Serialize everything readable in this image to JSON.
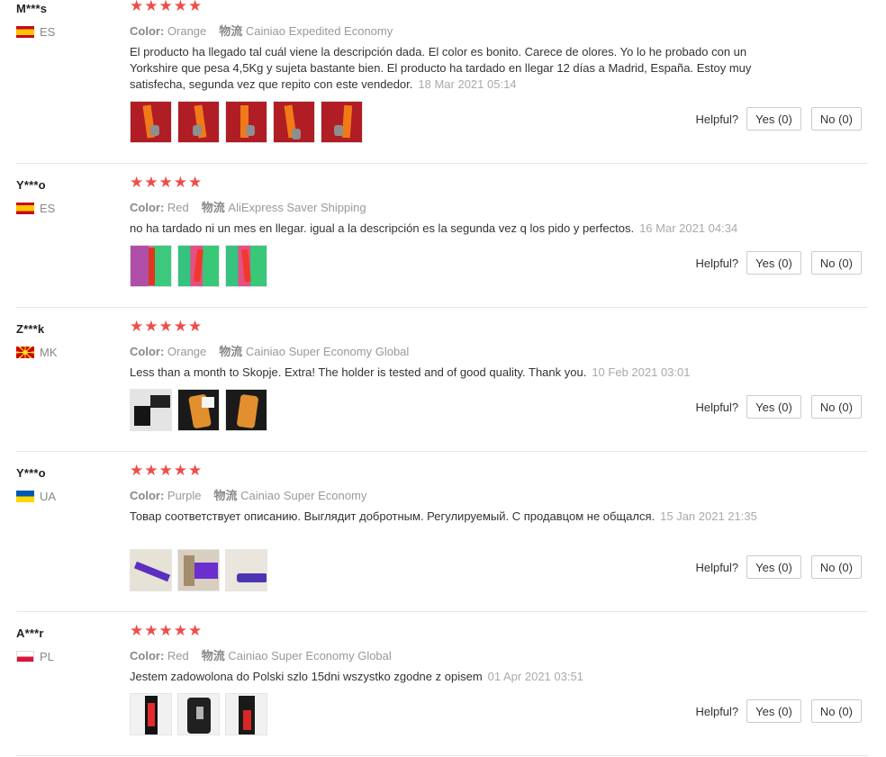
{
  "colors": {
    "star": "#f04c4c",
    "muted": "#999999",
    "divider": "#e8e8e8"
  },
  "icons": {
    "star": "★"
  },
  "reviews": [
    {
      "buyer": "M***s",
      "country": "ES",
      "flag": "es-flag-icon",
      "rating": 5,
      "color_label": "Color:",
      "color_value": "Orange",
      "shipping_label": "物流",
      "shipping": "Cainiao Expedited Economy",
      "text": "El producto ha llegado tal cuál viene la descripción dada. El color es bonito. Carece de olores. Yo lo he probado con un Yorkshire que pesa 4,5Kg y sujeta bastante bien. El producto ha tardado en llegar 12 días a Madrid, España. Estoy muy satisfecha, segunda vez que repito con este vendedor.",
      "date": "18 Mar 2021 05:14",
      "helpful_label": "Helpful?",
      "yes_label": "Yes (0)",
      "no_label": "No (0)"
    },
    {
      "buyer": "Y***o",
      "country": "ES",
      "flag": "es-flag-icon",
      "rating": 5,
      "color_label": "Color:",
      "color_value": "Red",
      "shipping_label": "物流",
      "shipping": "AliExpress Saver Shipping",
      "text": "no ha tardado ni un mes en llegar. igual a la descripción es la segunda vez q los pido y perfectos.",
      "date": "16 Mar 2021 04:34",
      "helpful_label": "Helpful?",
      "yes_label": "Yes (0)",
      "no_label": "No (0)"
    },
    {
      "buyer": "Z***k",
      "country": "MK",
      "flag": "mk-flag-icon",
      "rating": 5,
      "color_label": "Color:",
      "color_value": "Orange",
      "shipping_label": "物流",
      "shipping": "Cainiao Super Economy Global",
      "text": "Less than a month to Skopje. Extra! The holder is tested and of good quality. Thank you.",
      "date": "10 Feb 2021 03:01",
      "helpful_label": "Helpful?",
      "yes_label": "Yes (0)",
      "no_label": "No (0)"
    },
    {
      "buyer": "Y***o",
      "country": "UA",
      "flag": "ua-flag-icon",
      "rating": 5,
      "color_label": "Color:",
      "color_value": "Purple",
      "shipping_label": "物流",
      "shipping": "Cainiao Super Economy",
      "text": "Товар соответствует описанию. Выглядит добротным. Регулируемый. С продавцом не общался.",
      "date": "15 Jan 2021 21:35",
      "helpful_label": "Helpful?",
      "yes_label": "Yes (0)",
      "no_label": "No (0)"
    },
    {
      "buyer": "A***r",
      "country": "PL",
      "flag": "pl-flag-icon",
      "rating": 5,
      "color_label": "Color:",
      "color_value": "Red",
      "shipping_label": "物流",
      "shipping": "Cainiao Super Economy Global",
      "text": "Jestem zadowolona do Polski szlo 15dni wszystko zgodne z opisem",
      "date": "01 Apr 2021 03:51",
      "helpful_label": "Helpful?",
      "yes_label": "Yes (0)",
      "no_label": "No (0)"
    }
  ]
}
